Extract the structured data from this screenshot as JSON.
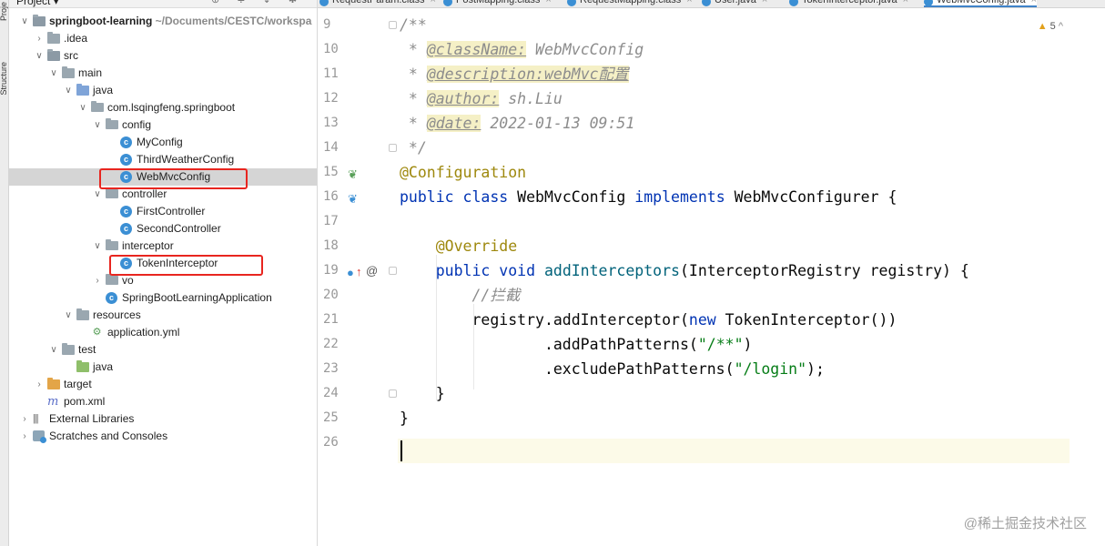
{
  "side_strip": {
    "tabs": [
      "Proje",
      "Structure"
    ]
  },
  "project_panel": {
    "header_title": "Project ▾",
    "header_icons": "⊕ ≑ ⇣ ✱",
    "tree": [
      {
        "label": "springboot-learning",
        "hint": "~/Documents/CESTC/workspa",
        "depth": 0,
        "open": true,
        "icon": "module"
      },
      {
        "label": ".idea",
        "depth": 1,
        "open": false,
        "icon": "folder"
      },
      {
        "label": "src",
        "depth": 1,
        "open": true,
        "icon": "folder-src"
      },
      {
        "label": "main",
        "depth": 2,
        "open": true,
        "icon": "folder"
      },
      {
        "label": "java",
        "depth": 3,
        "open": true,
        "icon": "folder-java"
      },
      {
        "label": "com.lsqingfeng.springboot",
        "depth": 4,
        "open": true,
        "icon": "package"
      },
      {
        "label": "config",
        "depth": 5,
        "open": true,
        "icon": "package"
      },
      {
        "label": "MyConfig",
        "depth": 6,
        "icon": "class"
      },
      {
        "label": "ThirdWeatherConfig",
        "depth": 6,
        "icon": "class"
      },
      {
        "label": "WebMvcConfig",
        "depth": 6,
        "icon": "class",
        "selected": true
      },
      {
        "label": "controller",
        "depth": 5,
        "open": true,
        "icon": "package"
      },
      {
        "label": "FirstController",
        "depth": 6,
        "icon": "class"
      },
      {
        "label": "SecondController",
        "depth": 6,
        "icon": "class"
      },
      {
        "label": "interceptor",
        "depth": 5,
        "open": true,
        "icon": "package"
      },
      {
        "label": "TokenInterceptor",
        "depth": 6,
        "icon": "class"
      },
      {
        "label": "vo",
        "depth": 5,
        "open": false,
        "icon": "package"
      },
      {
        "label": "SpringBootLearningApplication",
        "depth": 5,
        "icon": "class"
      },
      {
        "label": "resources",
        "depth": 3,
        "open": true,
        "icon": "folder-res"
      },
      {
        "label": "application.yml",
        "depth": 4,
        "icon": "yml"
      },
      {
        "label": "test",
        "depth": 2,
        "open": true,
        "icon": "folder"
      },
      {
        "label": "java",
        "depth": 3,
        "icon": "folder-test"
      },
      {
        "label": "target",
        "depth": 1,
        "open": false,
        "icon": "folder-target"
      },
      {
        "label": "pom.xml",
        "depth": 1,
        "icon": "pom"
      },
      {
        "label": "External Libraries",
        "depth": 0,
        "open": false,
        "icon": "lib"
      },
      {
        "label": "Scratches and Consoles",
        "depth": 0,
        "open": false,
        "icon": "scratch"
      }
    ]
  },
  "tabs": [
    {
      "label": "RequestParam.class",
      "active": false
    },
    {
      "label": "PostMapping.class",
      "active": false
    },
    {
      "label": "RequestMapping.class",
      "active": false
    },
    {
      "label": "User.java",
      "active": false
    },
    {
      "label": "TokenInterceptor.java",
      "active": false
    },
    {
      "label": "WebMvcConfig.java",
      "active": true
    }
  ],
  "editor": {
    "warning_count": "5",
    "line_numbers": [
      "9",
      "10",
      "11",
      "12",
      "13",
      "14",
      "15",
      "16",
      "17",
      "18",
      "19",
      "20",
      "21",
      "22",
      "23",
      "24",
      "25",
      "26"
    ],
    "code": {
      "l9": "/**",
      "l10_star": " * ",
      "l10_tag": "@className:",
      "l10_val": " WebMvcConfig",
      "l11_star": " * ",
      "l11_tag": "@description:webMvc配置",
      "l12_star": " * ",
      "l12_tag": "@author:",
      "l12_val": " sh.Liu",
      "l13_star": " * ",
      "l13_tag": "@date:",
      "l13_val": " 2022-01-13 09:51",
      "l14": " */",
      "l15": "@Configuration",
      "l16_kw": "public class",
      "l16_name": " WebMvcConfig ",
      "l16_kw2": "implements",
      "l16_rest": " WebMvcConfigurer {",
      "l18": "    @Override",
      "l19_kw": "    public void",
      "l19_method": " addInterceptors",
      "l19_rest": "(InterceptorRegistry registry) {",
      "l20": "        //拦截",
      "l21_a": "        registry.addInterceptor(",
      "l21_kw": "new",
      "l21_b": " TokenInterceptor())",
      "l22_a": "                .addPathPatterns(",
      "l22_str": "\"/**\"",
      "l22_b": ")",
      "l23_a": "                .excludePathPatterns(",
      "l23_str": "\"/login\"",
      "l23_b": ");",
      "l24": "    }",
      "l25": "}"
    }
  },
  "watermark": "@稀土掘金技术社区"
}
